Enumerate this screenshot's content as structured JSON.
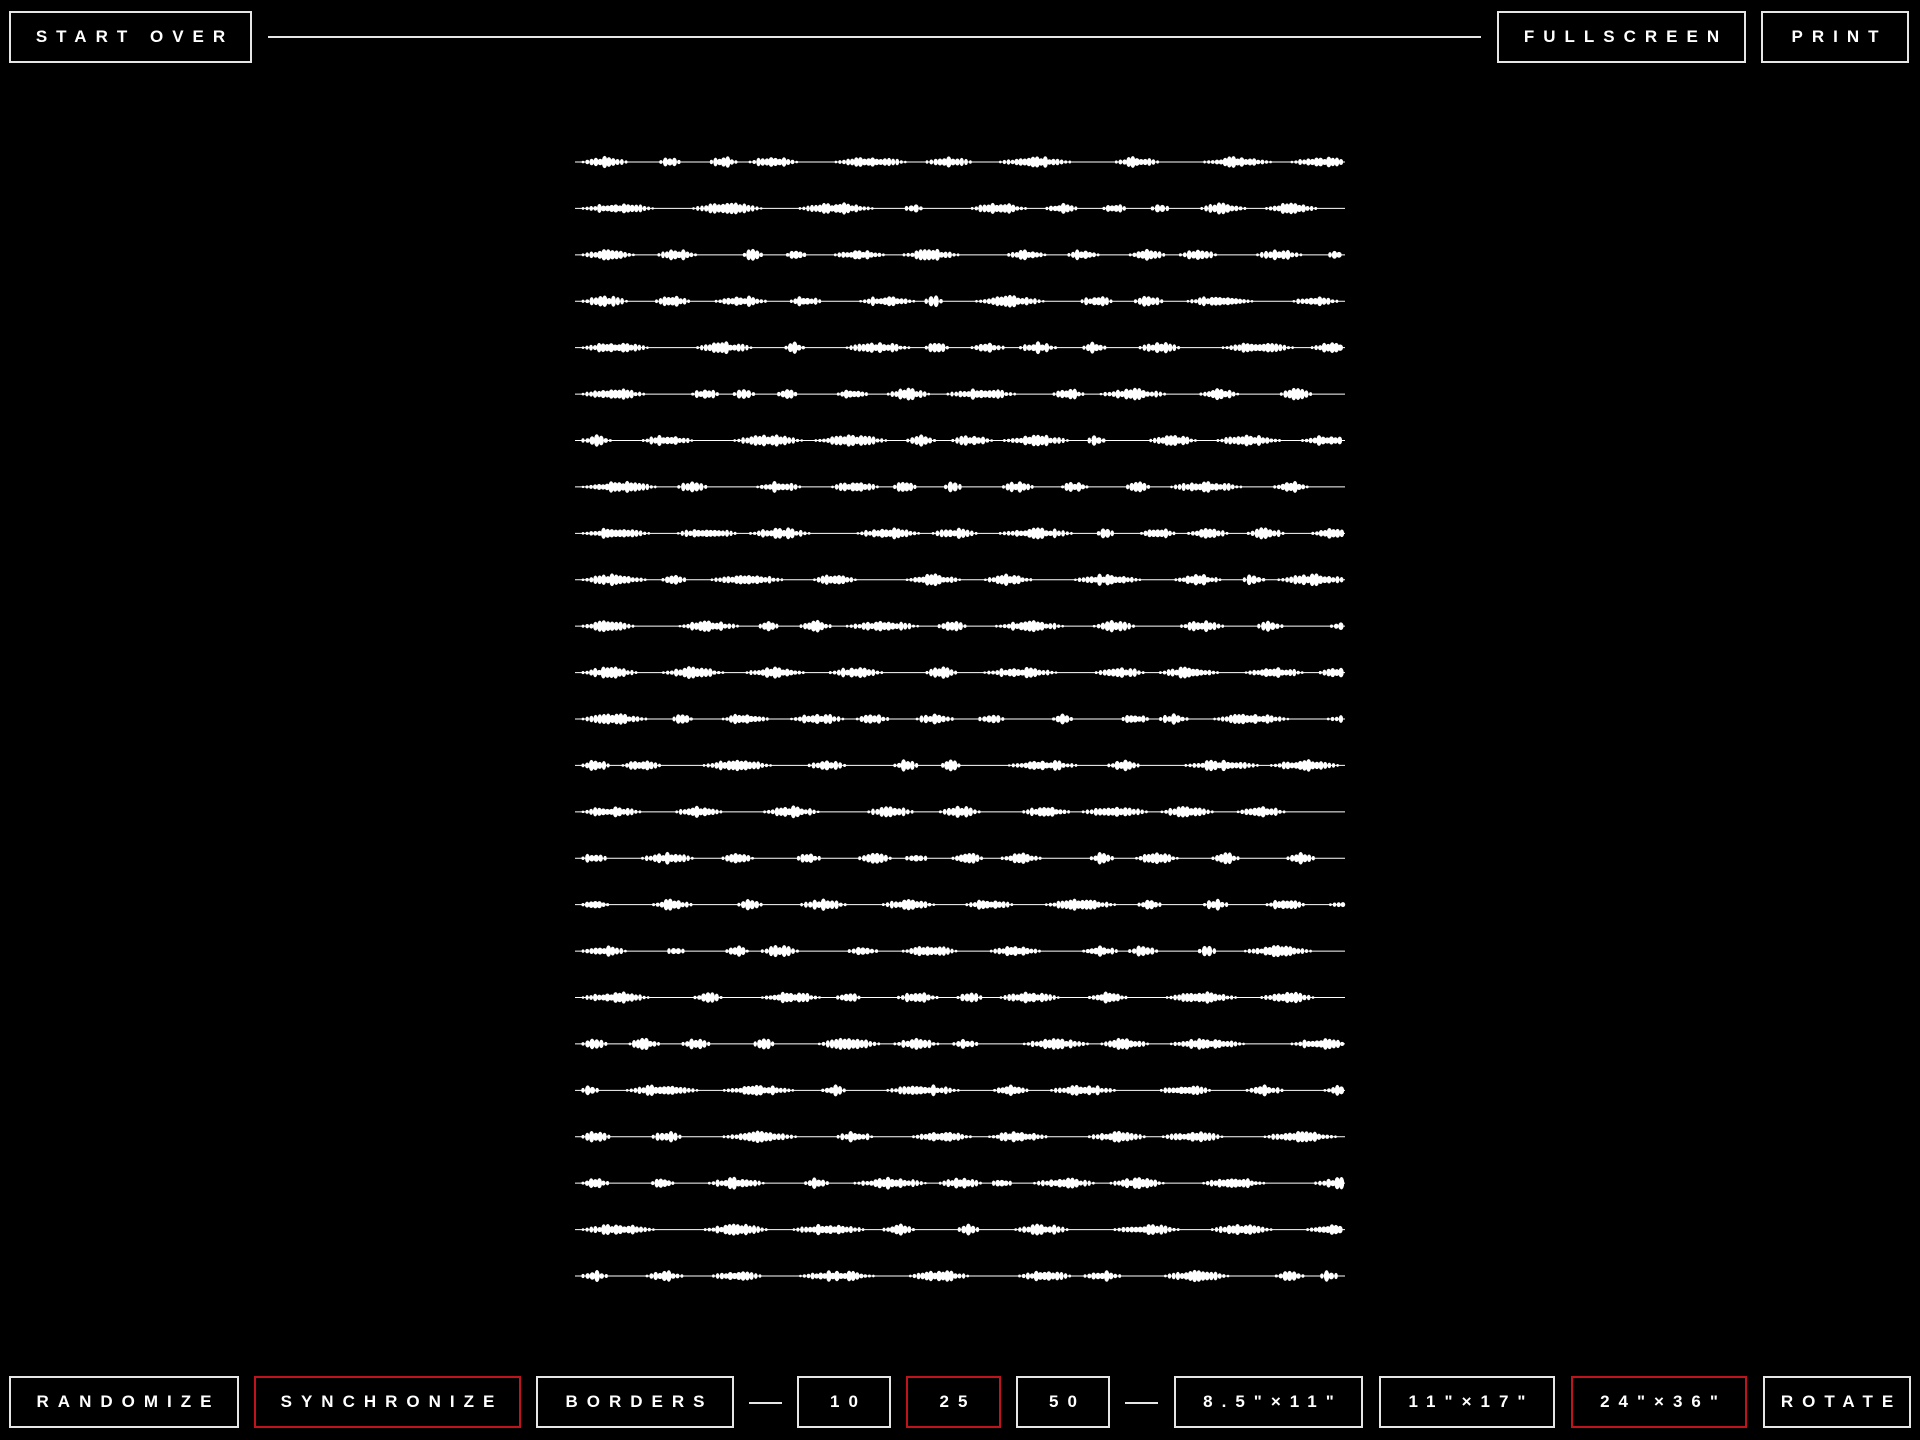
{
  "top_bar": {
    "start_over_label": "START OVER",
    "fullscreen_label": "FULLSCREEN",
    "print_label": "PRINT"
  },
  "bottom_bar": {
    "randomize_label": "RANDOMIZE",
    "synchronize_label": "SYNCHRONIZE",
    "borders_label": "BORDERS",
    "line_counts": [
      "10",
      "25",
      "50"
    ],
    "paper_sizes": [
      "8.5\"×11\"",
      "11\"×17\"",
      "24\"×36\""
    ],
    "rotate_label": "ROTATE"
  },
  "state": {
    "synchronize_active": true,
    "selected_line_count": "25",
    "selected_paper_size": "24\"×36\""
  },
  "artwork": {
    "waveform_rows": 25
  },
  "colors": {
    "background": "#000000",
    "foreground": "#ffffff",
    "active_border": "#c0141c"
  }
}
